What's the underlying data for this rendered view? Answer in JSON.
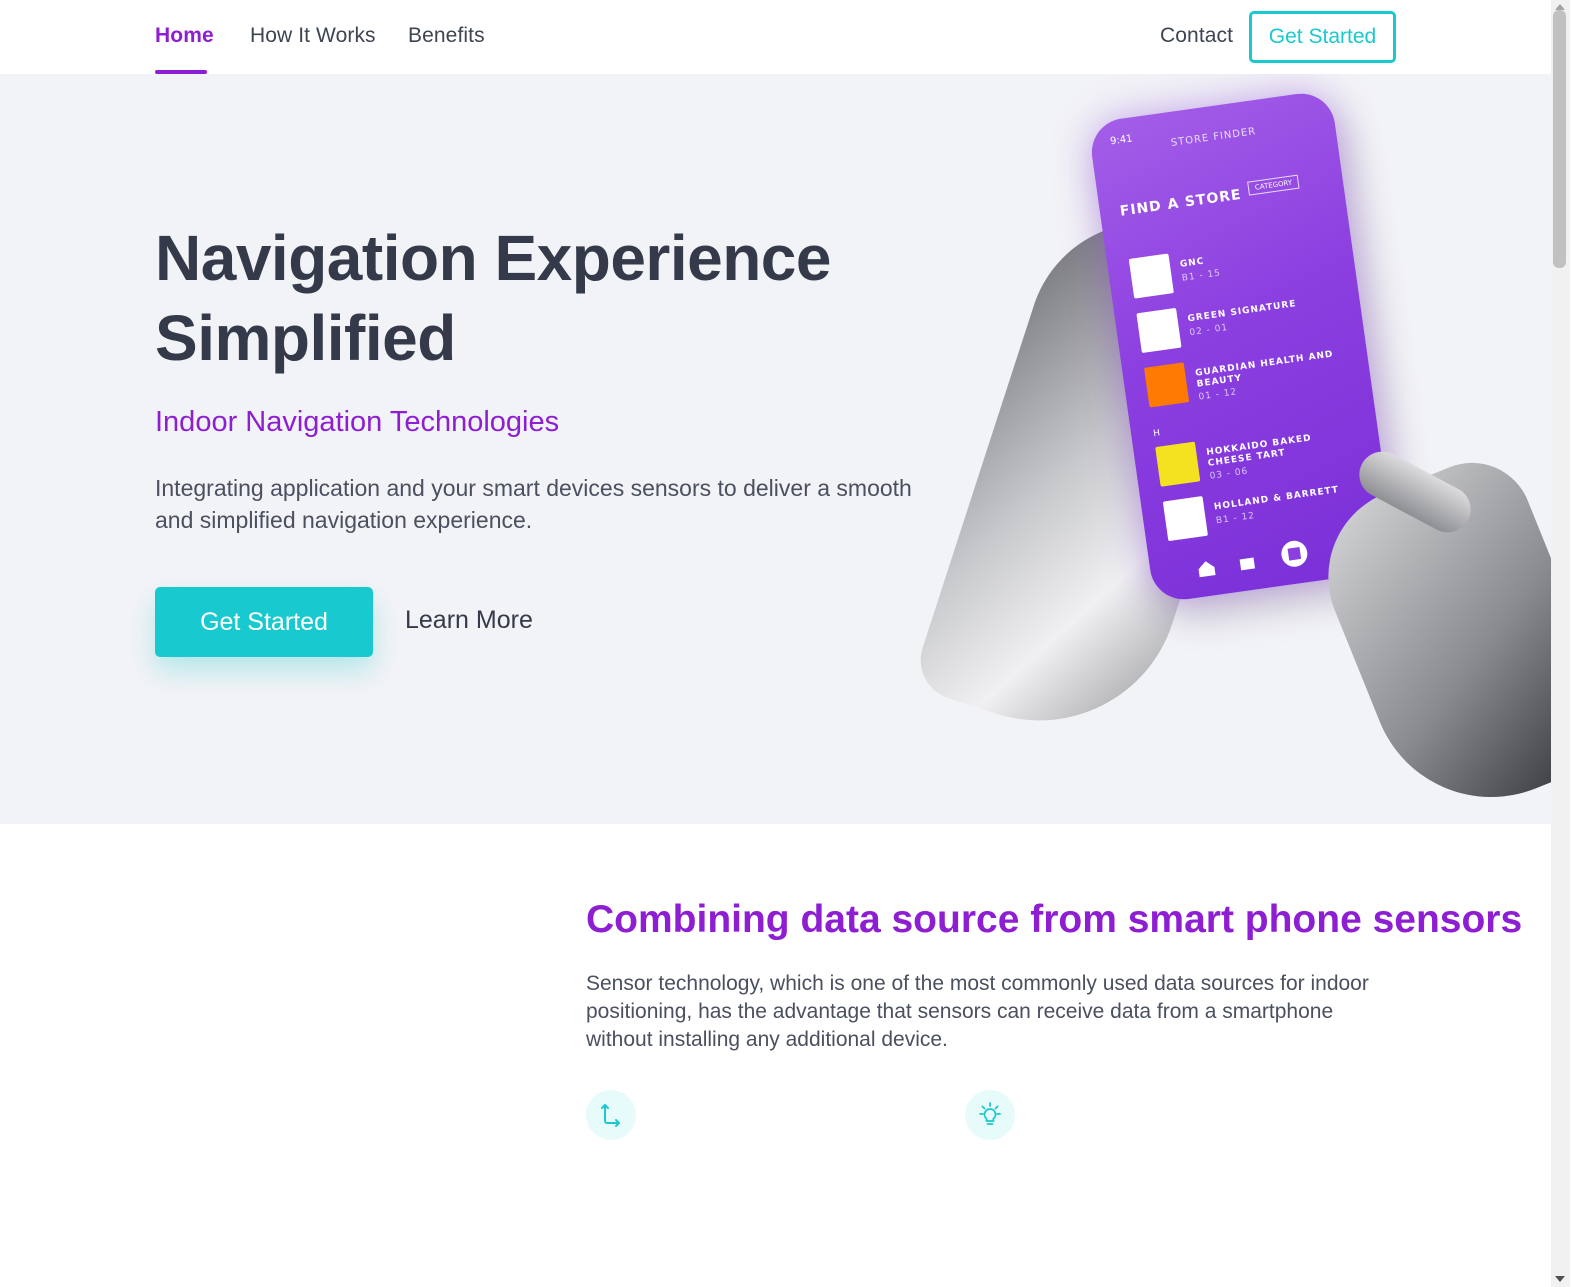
{
  "nav": {
    "items": [
      {
        "label": "Home",
        "active": true
      },
      {
        "label": "How It Works",
        "active": false
      },
      {
        "label": "Benefits",
        "active": false
      }
    ],
    "contact": "Contact",
    "cta": "Get Started"
  },
  "hero": {
    "title_line1": "Navigation Experience",
    "title_line2": "Simplified",
    "subtitle": "Indoor Navigation Technologies",
    "description": "Integrating application and your smart devices sensors to deliver a smooth and simplified navigation experience.",
    "primary_button": "Get Started",
    "secondary_button": "Learn More",
    "illustration": {
      "status_time": "9:41",
      "screen_header": "STORE FINDER",
      "screen_title": "FIND A STORE",
      "category_label": "CATEGORY",
      "stores": [
        {
          "name": "GNC",
          "unit": "B1 - 15"
        },
        {
          "name": "GREEN SIGNATURE",
          "unit": "02 - 01"
        },
        {
          "name": "GUARDIAN HEALTH AND BEAUTY",
          "unit": "01 - 12"
        },
        {
          "name": "HOKKAIDO BAKED CHEESE TART",
          "unit": "03 - 06"
        },
        {
          "name": "HOLLAND & BARRETT",
          "unit": "B1 - 12"
        }
      ],
      "letter_divider": "H"
    }
  },
  "section": {
    "title": "Combining data source from smart phone sensors",
    "description": "Sensor technology, which is one of the most commonly used data sources for indoor positioning, has the advantage that sensors can receive data from a smartphone without installing any additional device.",
    "features": [
      {
        "icon": "axis-icon"
      },
      {
        "icon": "lightbulb-icon"
      }
    ]
  },
  "colors": {
    "accent_purple": "#8e1ed2",
    "accent_teal": "#19c9d0",
    "text_dark": "#343a4a",
    "hero_bg": "#f2f3f6"
  }
}
